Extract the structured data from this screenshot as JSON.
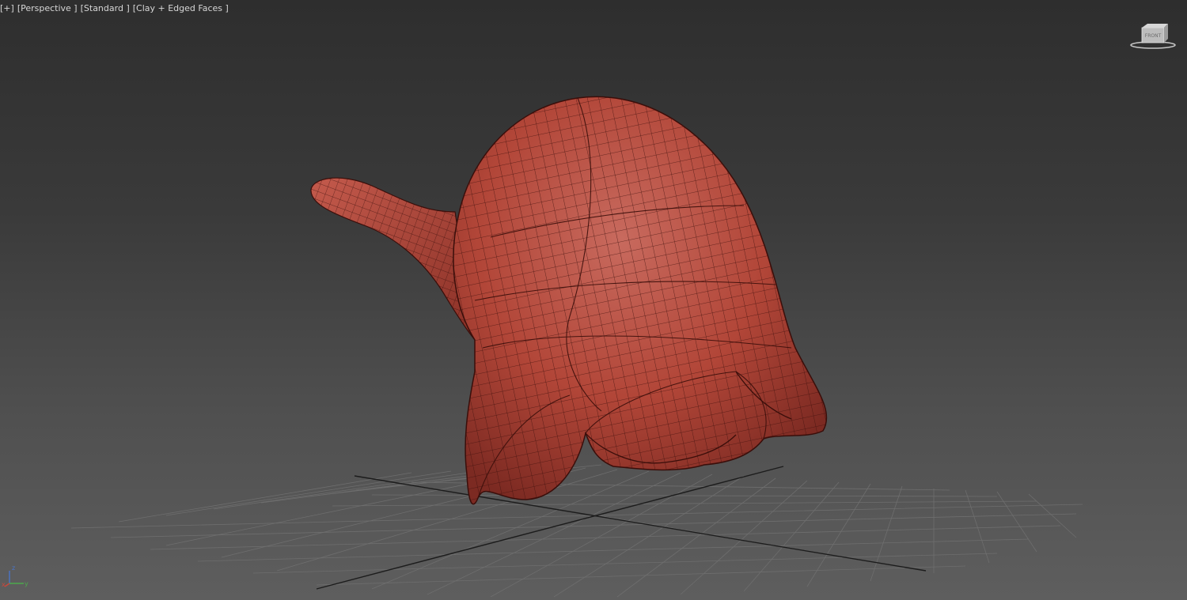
{
  "viewport": {
    "labels": {
      "plus": "[+]",
      "view": "[Perspective ]",
      "shading_style": "[Standard ]",
      "display_mode": "[Clay + Edged Faces ]"
    },
    "viewcube": {
      "icon": "viewcube-icon",
      "text": "FRONT"
    },
    "axis": {
      "z": "z",
      "x": "x",
      "y": "y"
    }
  },
  "colors": {
    "model": "#b24638",
    "model_edge": "#3a0e0a",
    "grid": "#6e6e6e",
    "grid_main_axis": "#1c1c1c",
    "background_top": "#2e2e2e",
    "background_bottom": "#5e5e5e",
    "axis_x": "#c8483c",
    "axis_y": "#4caa4c",
    "axis_z": "#4a74c8"
  }
}
